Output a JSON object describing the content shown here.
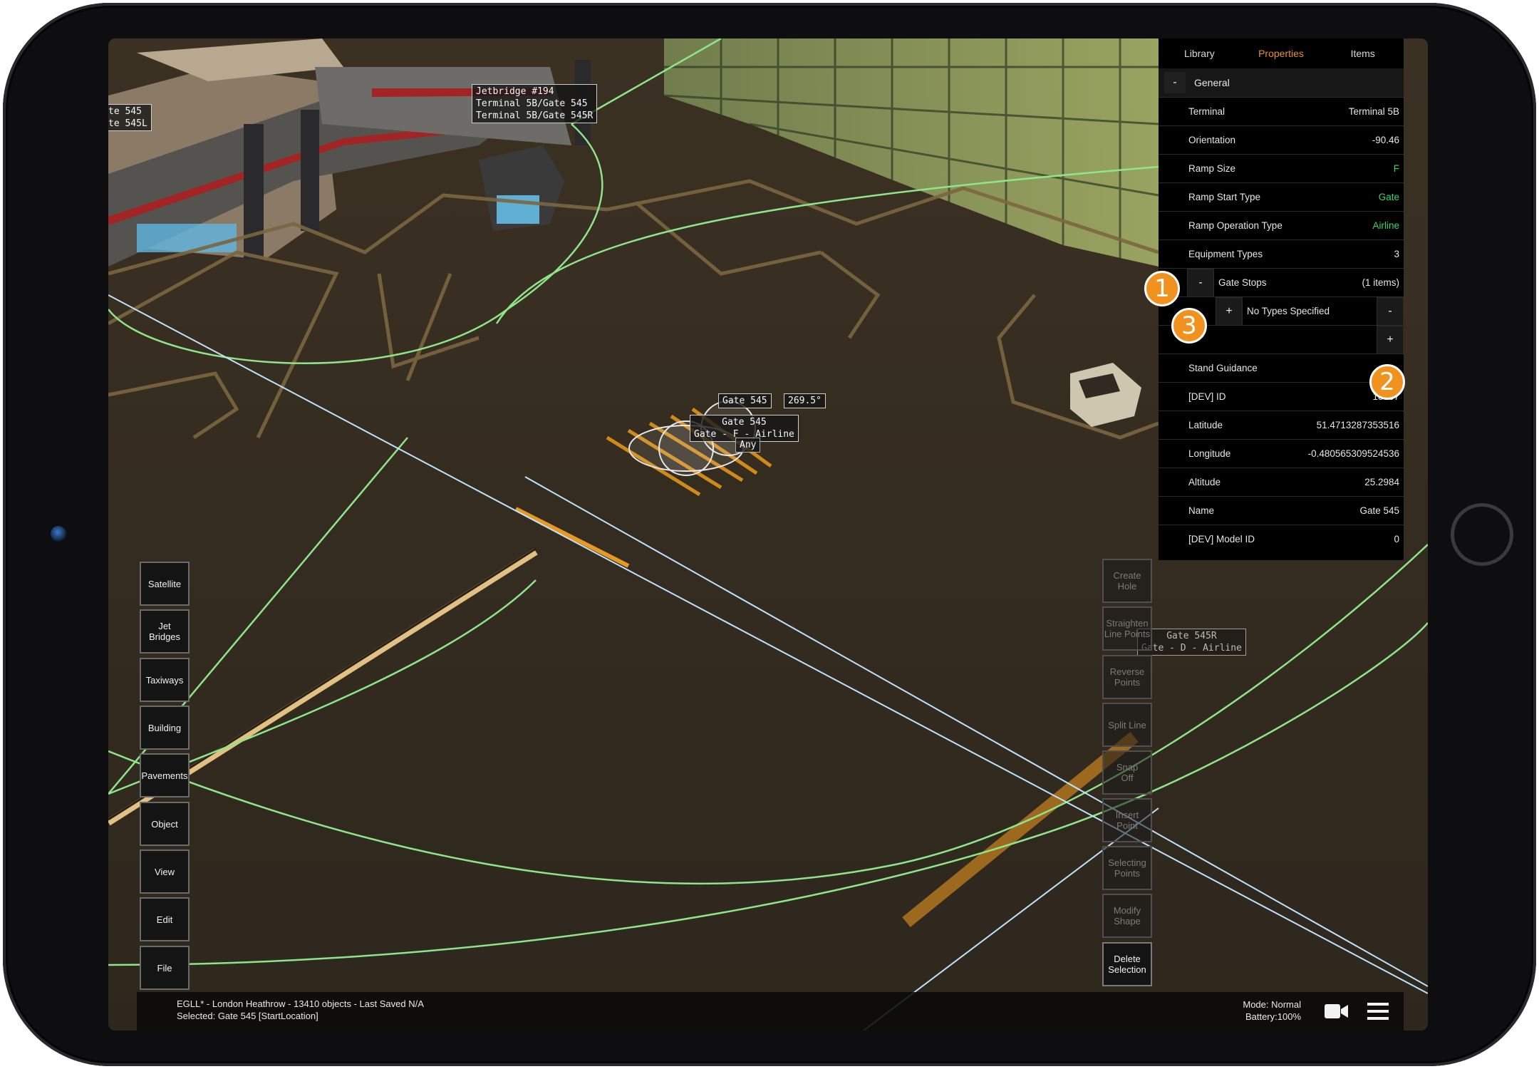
{
  "panel": {
    "tabs": [
      "Library",
      "Properties",
      "Items"
    ],
    "active_tab": "Properties",
    "section_toggle": "-",
    "section_title": "General",
    "rows": [
      {
        "label": "Terminal",
        "value": "Terminal 5B"
      },
      {
        "label": "Orientation",
        "value": "-90.46"
      },
      {
        "label": "Ramp Size",
        "value": "F"
      },
      {
        "label": "Ramp Start Type",
        "value": "Gate"
      },
      {
        "label": "Ramp Operation Type",
        "value": "Airline"
      },
      {
        "label": "Equipment Types",
        "value": "3"
      }
    ],
    "gate_stops": {
      "toggle": "-",
      "label": "Gate Stops",
      "count": "(1 items)"
    },
    "gate_stop_item": {
      "expand": "+",
      "label": "No Types Specified",
      "remove": "-"
    },
    "add_button": "+",
    "rows2": [
      {
        "label": "Stand Guidance",
        "value": ""
      },
      {
        "label": "[DEV] ID",
        "value": "13057"
      },
      {
        "label": "Latitude",
        "value": "51.4713287353516"
      },
      {
        "label": "Longitude",
        "value": "-0.480565309524536"
      },
      {
        "label": "Altitude",
        "value": "25.2984"
      },
      {
        "label": "Name",
        "value": "Gate 545"
      },
      {
        "label": "[DEV] Model ID",
        "value": "0"
      }
    ]
  },
  "badges": [
    "1",
    "2",
    "3"
  ],
  "left_buttons": [
    "Satellite",
    "Jet\nBridges",
    "Taxiways",
    "Building",
    "Pavements",
    "Object",
    "View",
    "Edit",
    "File"
  ],
  "right_buttons": [
    "Create\nHole",
    "Straighten\nLine Points",
    "Reverse\nPoints",
    "Split Line",
    "Snap\nOff",
    "Insert\nPoint",
    "Selecting\nPoints",
    "Modify\nShape",
    "Delete\nSelection"
  ],
  "status": {
    "line1": "EGLL* - London Heathrow - 13410 objects - Last Saved N/A",
    "line2": "Selected: Gate 545 [StartLocation]",
    "mode": "Mode: Normal",
    "battery": "Battery:100%"
  },
  "scene_labels": {
    "jetbridge": "Jetbridge #194\nTerminal 5B/Gate 545\nTerminal 5B/Gate 545R",
    "edge_left": "te 545\nte 545L",
    "gate_top": "Gate 545",
    "heading": "269.5°",
    "gate_mid": "Gate 545\nGate - F - Airline",
    "any": "Any",
    "gate_r": "Gate 545R\nGate - D - Airline"
  },
  "colors": {
    "accent": "#e8922c",
    "green_value": "#37d66b",
    "badge": "#f2921e"
  }
}
